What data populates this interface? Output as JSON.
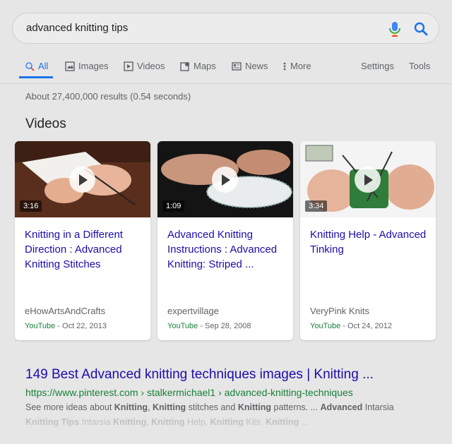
{
  "search": {
    "query": "advanced knitting tips"
  },
  "tabs": [
    {
      "label": "All",
      "icon": "search-icon"
    },
    {
      "label": "Images",
      "icon": "image-icon"
    },
    {
      "label": "Videos",
      "icon": "video-icon"
    },
    {
      "label": "Maps",
      "icon": "map-icon"
    },
    {
      "label": "News",
      "icon": "news-icon"
    },
    {
      "label": "More",
      "icon": "more-vert-icon"
    },
    {
      "label": "Settings"
    },
    {
      "label": "Tools"
    }
  ],
  "result_stats": "About 27,400,000 results (0.54 seconds)",
  "videos_heading": "Videos",
  "videos": [
    {
      "duration": "3:16",
      "title": "Knitting in a Different Direction : Advanced Knitting Stitches",
      "channel": "eHowArtsAndCrafts",
      "source": "YouTube",
      "date": " - Oct 22, 2013"
    },
    {
      "duration": "1:09",
      "title": "Advanced Knitting Instructions : Advanced Knitting: Striped ...",
      "channel": "expertvillage",
      "source": "YouTube",
      "date": " - Sep 28, 2008"
    },
    {
      "duration": "3:34",
      "title": "Knitting Help - Advanced Tinking",
      "channel": "VeryPink Knits",
      "source": "YouTube",
      "date": " - Oct 24, 2012"
    }
  ],
  "result": {
    "title": "149 Best Advanced knitting techniques images | Knitting ...",
    "url": "https://www.pinterest.com › stalkermichael1 › advanced-knitting-techniques",
    "snippet_line1": [
      {
        "t": "See more ideas about ",
        "b": false
      },
      {
        "t": "Knitting",
        "b": true
      },
      {
        "t": ", ",
        "b": false
      },
      {
        "t": "Knitting",
        "b": true
      },
      {
        "t": " stitches and ",
        "b": false
      },
      {
        "t": "Knitting",
        "b": true
      },
      {
        "t": " patterns. ... ",
        "b": false
      },
      {
        "t": "Advanced",
        "b": true
      },
      {
        "t": " Intarsia",
        "b": false
      }
    ],
    "snippet_line2": [
      {
        "t": "Knitting Tips",
        "b": true
      },
      {
        "t": " Intarsia ",
        "b": false
      },
      {
        "t": "Knitting",
        "b": true
      },
      {
        "t": ", ",
        "b": false
      },
      {
        "t": "Knitting",
        "b": true
      },
      {
        "t": " Help, ",
        "b": false
      },
      {
        "t": "Knitting",
        "b": true
      },
      {
        "t": " Kits, ",
        "b": false
      },
      {
        "t": "Knitting",
        "b": true
      },
      {
        "t": " ...",
        "b": false
      }
    ]
  },
  "colors": {
    "link": "#1a0dab",
    "accent": "#1a73e8",
    "url_green": "#188038"
  }
}
